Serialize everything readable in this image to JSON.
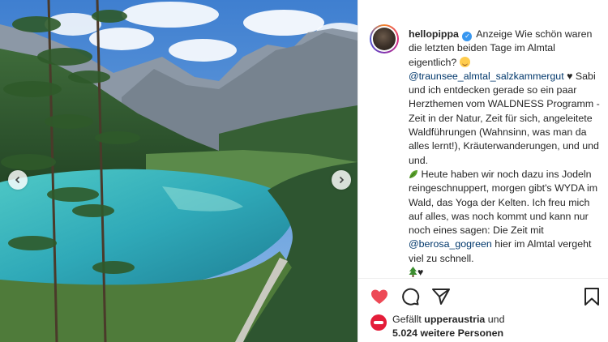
{
  "post": {
    "username": "hellopippa",
    "caption_parts": {
      "intro": "Anzeige Wie schön waren die letzten beiden Tage im Almtal eigentlich?",
      "mention_1": "@traunsee_almtal_salzkammergut",
      "heart": "♥",
      "body_1": "Sabi und ich entdecken gerade so ein paar Herzthemen vom WALDNESS Programm - Zeit in der Natur, Zeit für sich, angeleitete Waldführungen (Wahnsinn, was man da alles lernt!), Kräuterwanderungen, und und und.",
      "body_2": "Heute haben wir noch dazu ins Jodeln reingeschnuppert, morgen gibt's WYDA im Wald, das Yoga der Kelten. Ich freu mich auf alles, was noch kommt und kann nur noch eines sagen: Die Zeit mit",
      "mention_2": "@berosa_gogreen",
      "body_3": "hier im Almtal vergeht viel zu schnell.",
      "end_heart": "♥"
    },
    "likes": {
      "prefix": "Gefällt",
      "user": "upperaustria",
      "conjunction": "und",
      "others": "5.024 weitere Personen"
    },
    "icons": {
      "verified": "verified-badge-icon",
      "like": "heart-icon",
      "comment": "comment-bubble-icon",
      "share": "paper-plane-icon",
      "save": "bookmark-icon",
      "prev": "chevron-left-icon",
      "next": "chevron-right-icon"
    },
    "colors": {
      "like_red": "#ed4956",
      "link_blue": "#00376b",
      "verified_blue": "#3897f0"
    }
  }
}
